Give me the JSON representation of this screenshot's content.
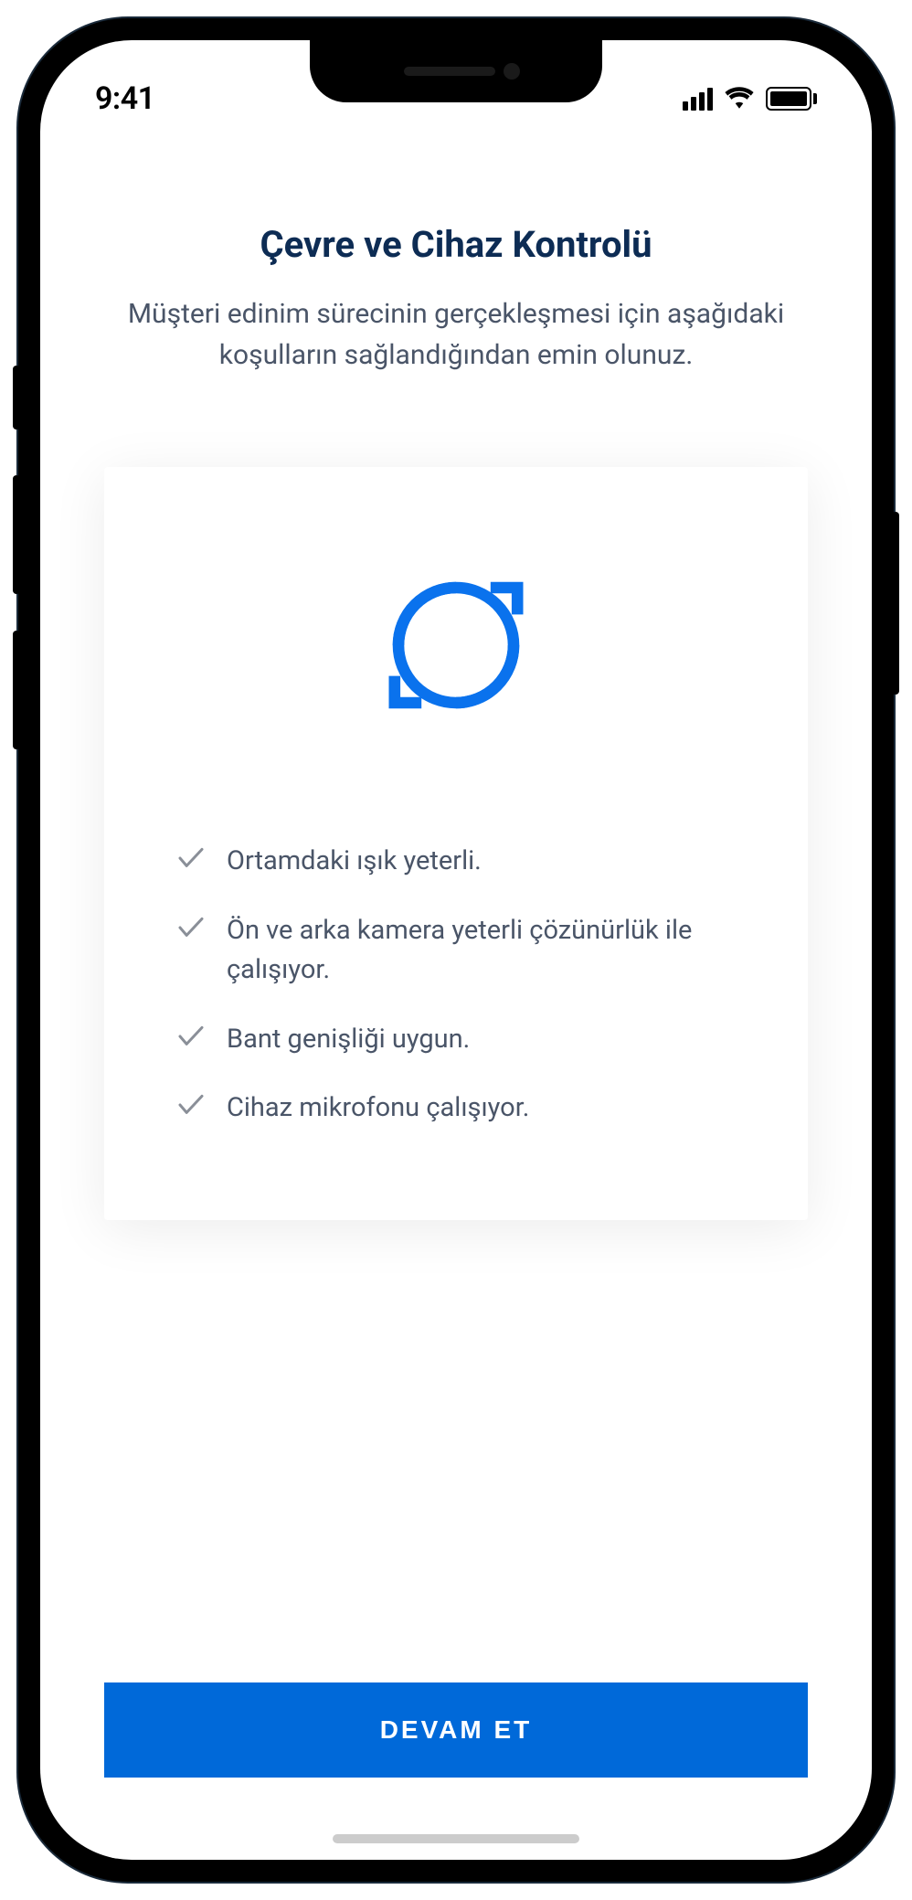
{
  "status": {
    "time": "9:41"
  },
  "page": {
    "title": "Çevre ve Cihaz Kontrolü",
    "subtitle": "Müşteri edinim sürecinin gerçekleşmesi için aşağıdaki koşulların sağlandığından emin olunuz."
  },
  "checklist": {
    "items": [
      "Ortamdaki ışık yeterli.",
      "Ön ve arka kamera yeterli çözünürlük ile çalışıyor.",
      "Bant genişliği uygun.",
      "Cihaz mikrofonu çalışıyor."
    ]
  },
  "button": {
    "continue_label": "DEVAM ET"
  },
  "colors": {
    "primary": "#0069d9",
    "title": "#0d2c54",
    "text": "#4a5568",
    "icon_blue": "#0a72ed"
  }
}
